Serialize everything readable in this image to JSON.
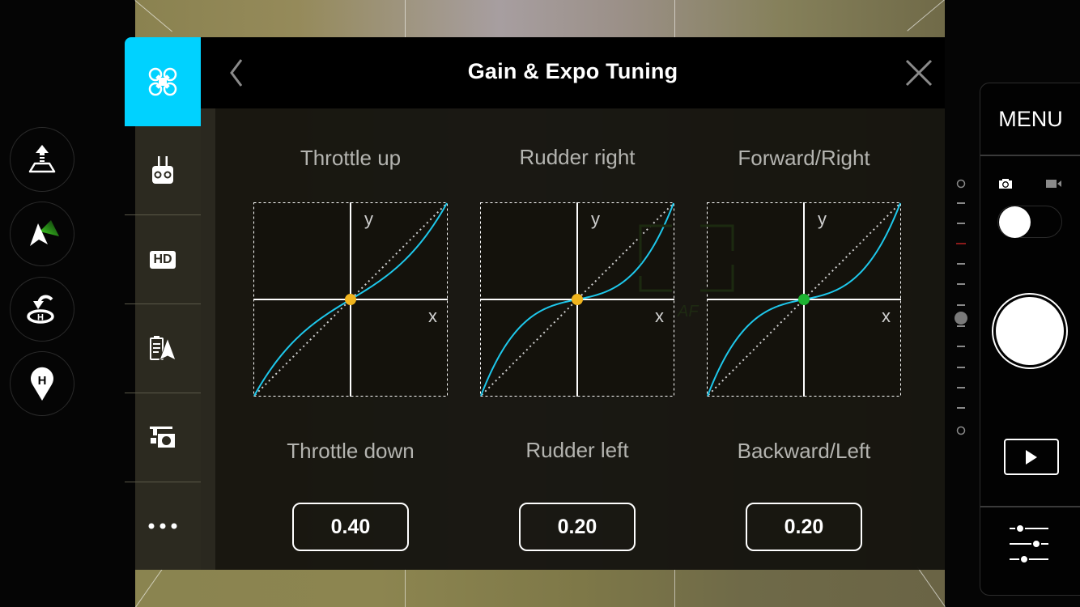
{
  "header": {
    "title": "Gain & Expo Tuning",
    "back_icon": "chevron-left-icon",
    "close_icon": "close-icon"
  },
  "left_flight_buttons": [
    {
      "name": "takeoff",
      "icon": "takeoff-icon"
    },
    {
      "name": "compass",
      "icon": "navigation-arrow-icon"
    },
    {
      "name": "return-home",
      "icon": "return-home-icon"
    },
    {
      "name": "home-point",
      "icon": "home-point-pin-icon"
    }
  ],
  "sidebar": {
    "items": [
      {
        "name": "aircraft",
        "icon": "drone-icon",
        "active": true
      },
      {
        "name": "remote-controller",
        "icon": "remote-controller-icon",
        "active": false
      },
      {
        "name": "video-transmission",
        "icon": "hd-icon",
        "label": "HD",
        "active": false
      },
      {
        "name": "battery",
        "icon": "battery-nav-icon",
        "active": false
      },
      {
        "name": "gimbal",
        "icon": "gimbal-camera-icon",
        "active": false
      },
      {
        "name": "more",
        "icon": "more-dots-icon",
        "active": false
      }
    ]
  },
  "curves": [
    {
      "top_label": "Throttle up",
      "bottom_label": "Throttle down",
      "value": "0.40",
      "expo": 0.4,
      "center_dot_color": "#f0b41e",
      "x_label": "x",
      "y_label": "y"
    },
    {
      "top_label": "Rudder right",
      "bottom_label": "Rudder left",
      "value": "0.20",
      "expo": 0.8,
      "center_dot_color": "#f0b41e",
      "x_label": "x",
      "y_label": "y"
    },
    {
      "top_label": "Forward/Right",
      "bottom_label": "Backward/Left",
      "value": "0.20",
      "expo": 0.8,
      "center_dot_color": "#1db332",
      "x_label": "x",
      "y_label": "y"
    }
  ],
  "colors": {
    "accent": "#00d2ff",
    "curve": "#1ec8ec"
  },
  "right_panel": {
    "menu_label": "MENU",
    "photo_icon": "camera-icon",
    "video_icon": "video-icon",
    "mode_toggle": "photo",
    "shutter_icon": "shutter-button",
    "playback_icon": "play-icon",
    "settings_icon": "sliders-icon"
  },
  "af_label": "AF"
}
